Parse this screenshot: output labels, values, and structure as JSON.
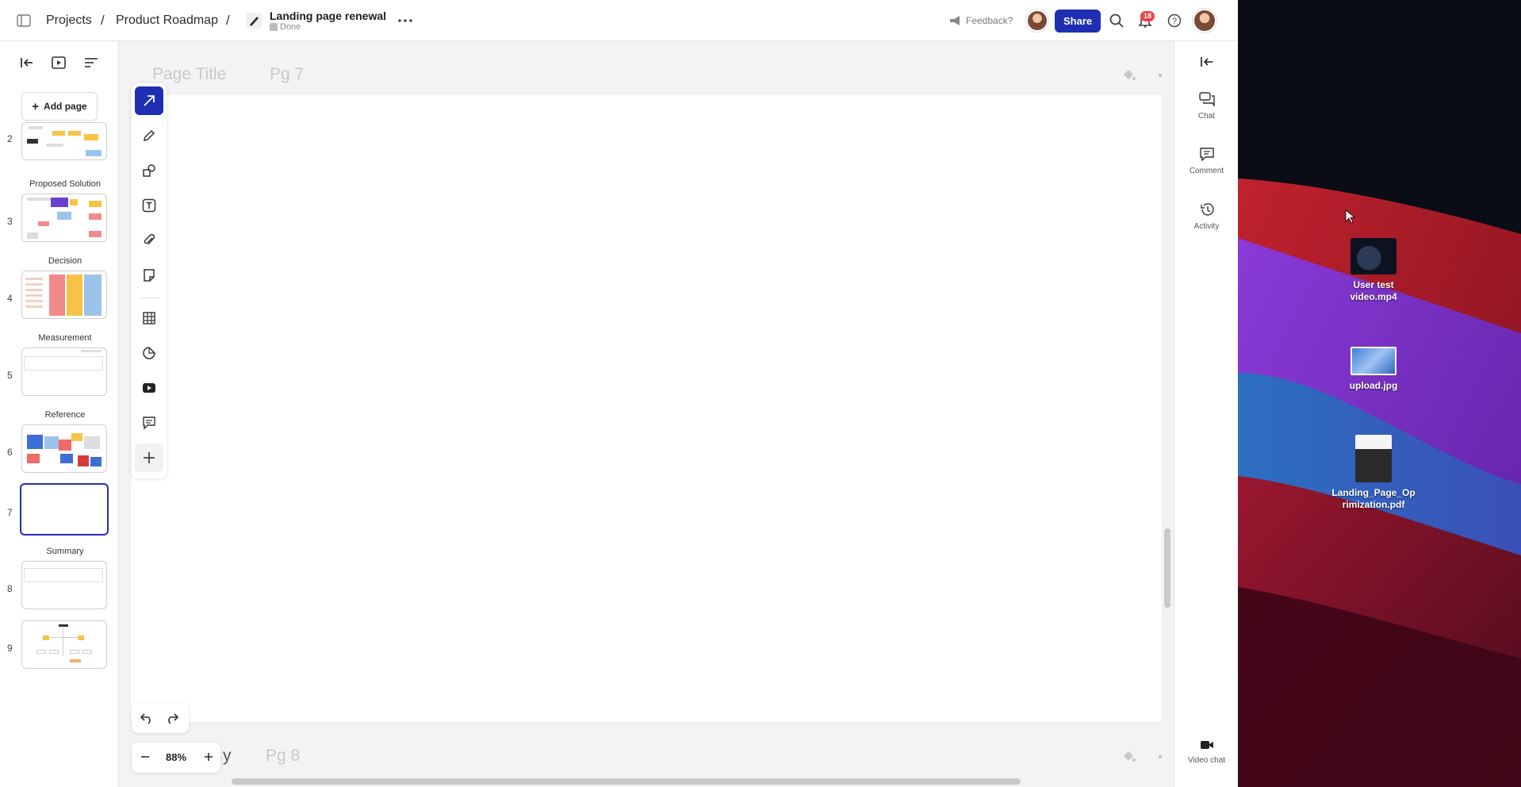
{
  "topbar": {
    "breadcrumb": [
      "Projects",
      "Product Roadmap"
    ],
    "separator": "/",
    "doc_title": "Landing page renewal",
    "doc_status": "Done",
    "feedback_label": "Feedback?",
    "share_label": "Share",
    "notification_count": "18",
    "icons": [
      "sidebar-toggle-icon",
      "pen-icon",
      "more-icon",
      "megaphone-icon",
      "search-icon",
      "bell-icon",
      "help-icon"
    ]
  },
  "left_panel": {
    "add_page_label": "Add page",
    "pages": [
      {
        "number": "2",
        "section": ""
      },
      {
        "number": "3",
        "section": "Proposed Solution"
      },
      {
        "number": "4",
        "section": "Decision"
      },
      {
        "number": "5",
        "section": "Measurement"
      },
      {
        "number": "6",
        "section": "Reference"
      },
      {
        "number": "7",
        "section": "",
        "active": true
      },
      {
        "number": "8",
        "section": "Summary"
      },
      {
        "number": "9",
        "section": ""
      }
    ]
  },
  "toolbar": {
    "tools": [
      "arrow-tool-icon",
      "pen-tool-icon",
      "shape-tool-icon",
      "text-tool-icon",
      "attach-tool-icon",
      "sticky-note-tool-icon",
      "table-tool-icon",
      "sticker-tool-icon",
      "video-embed-tool-icon",
      "comment-tool-icon",
      "add-tool-icon"
    ],
    "active_tool": "arrow-tool-icon"
  },
  "canvas": {
    "page_title_placeholder": "Page Title",
    "current_page_label": "Pg 7",
    "next_page_partial_title": "y",
    "next_page_label": "Pg 8"
  },
  "zoom": {
    "value": "88%"
  },
  "right_rail": {
    "items": [
      {
        "label": "Chat",
        "icon": "chat-icon"
      },
      {
        "label": "Comment",
        "icon": "comment-icon"
      },
      {
        "label": "Activity",
        "icon": "history-icon"
      }
    ],
    "video_chat_label": "Video chat"
  },
  "desktop": {
    "files": [
      {
        "name": "User test video.mp4",
        "line1": "User test",
        "line2": "video.mp4"
      },
      {
        "name": "upload.jpg",
        "line1": "upload.jpg",
        "line2": ""
      },
      {
        "name": "Landing_Page_Oprimization.pdf",
        "line1": "Landing_Page_Op",
        "line2": "rimization.pdf"
      }
    ]
  },
  "colors": {
    "accent": "#1f2fb3",
    "badge": "#e8434a"
  }
}
